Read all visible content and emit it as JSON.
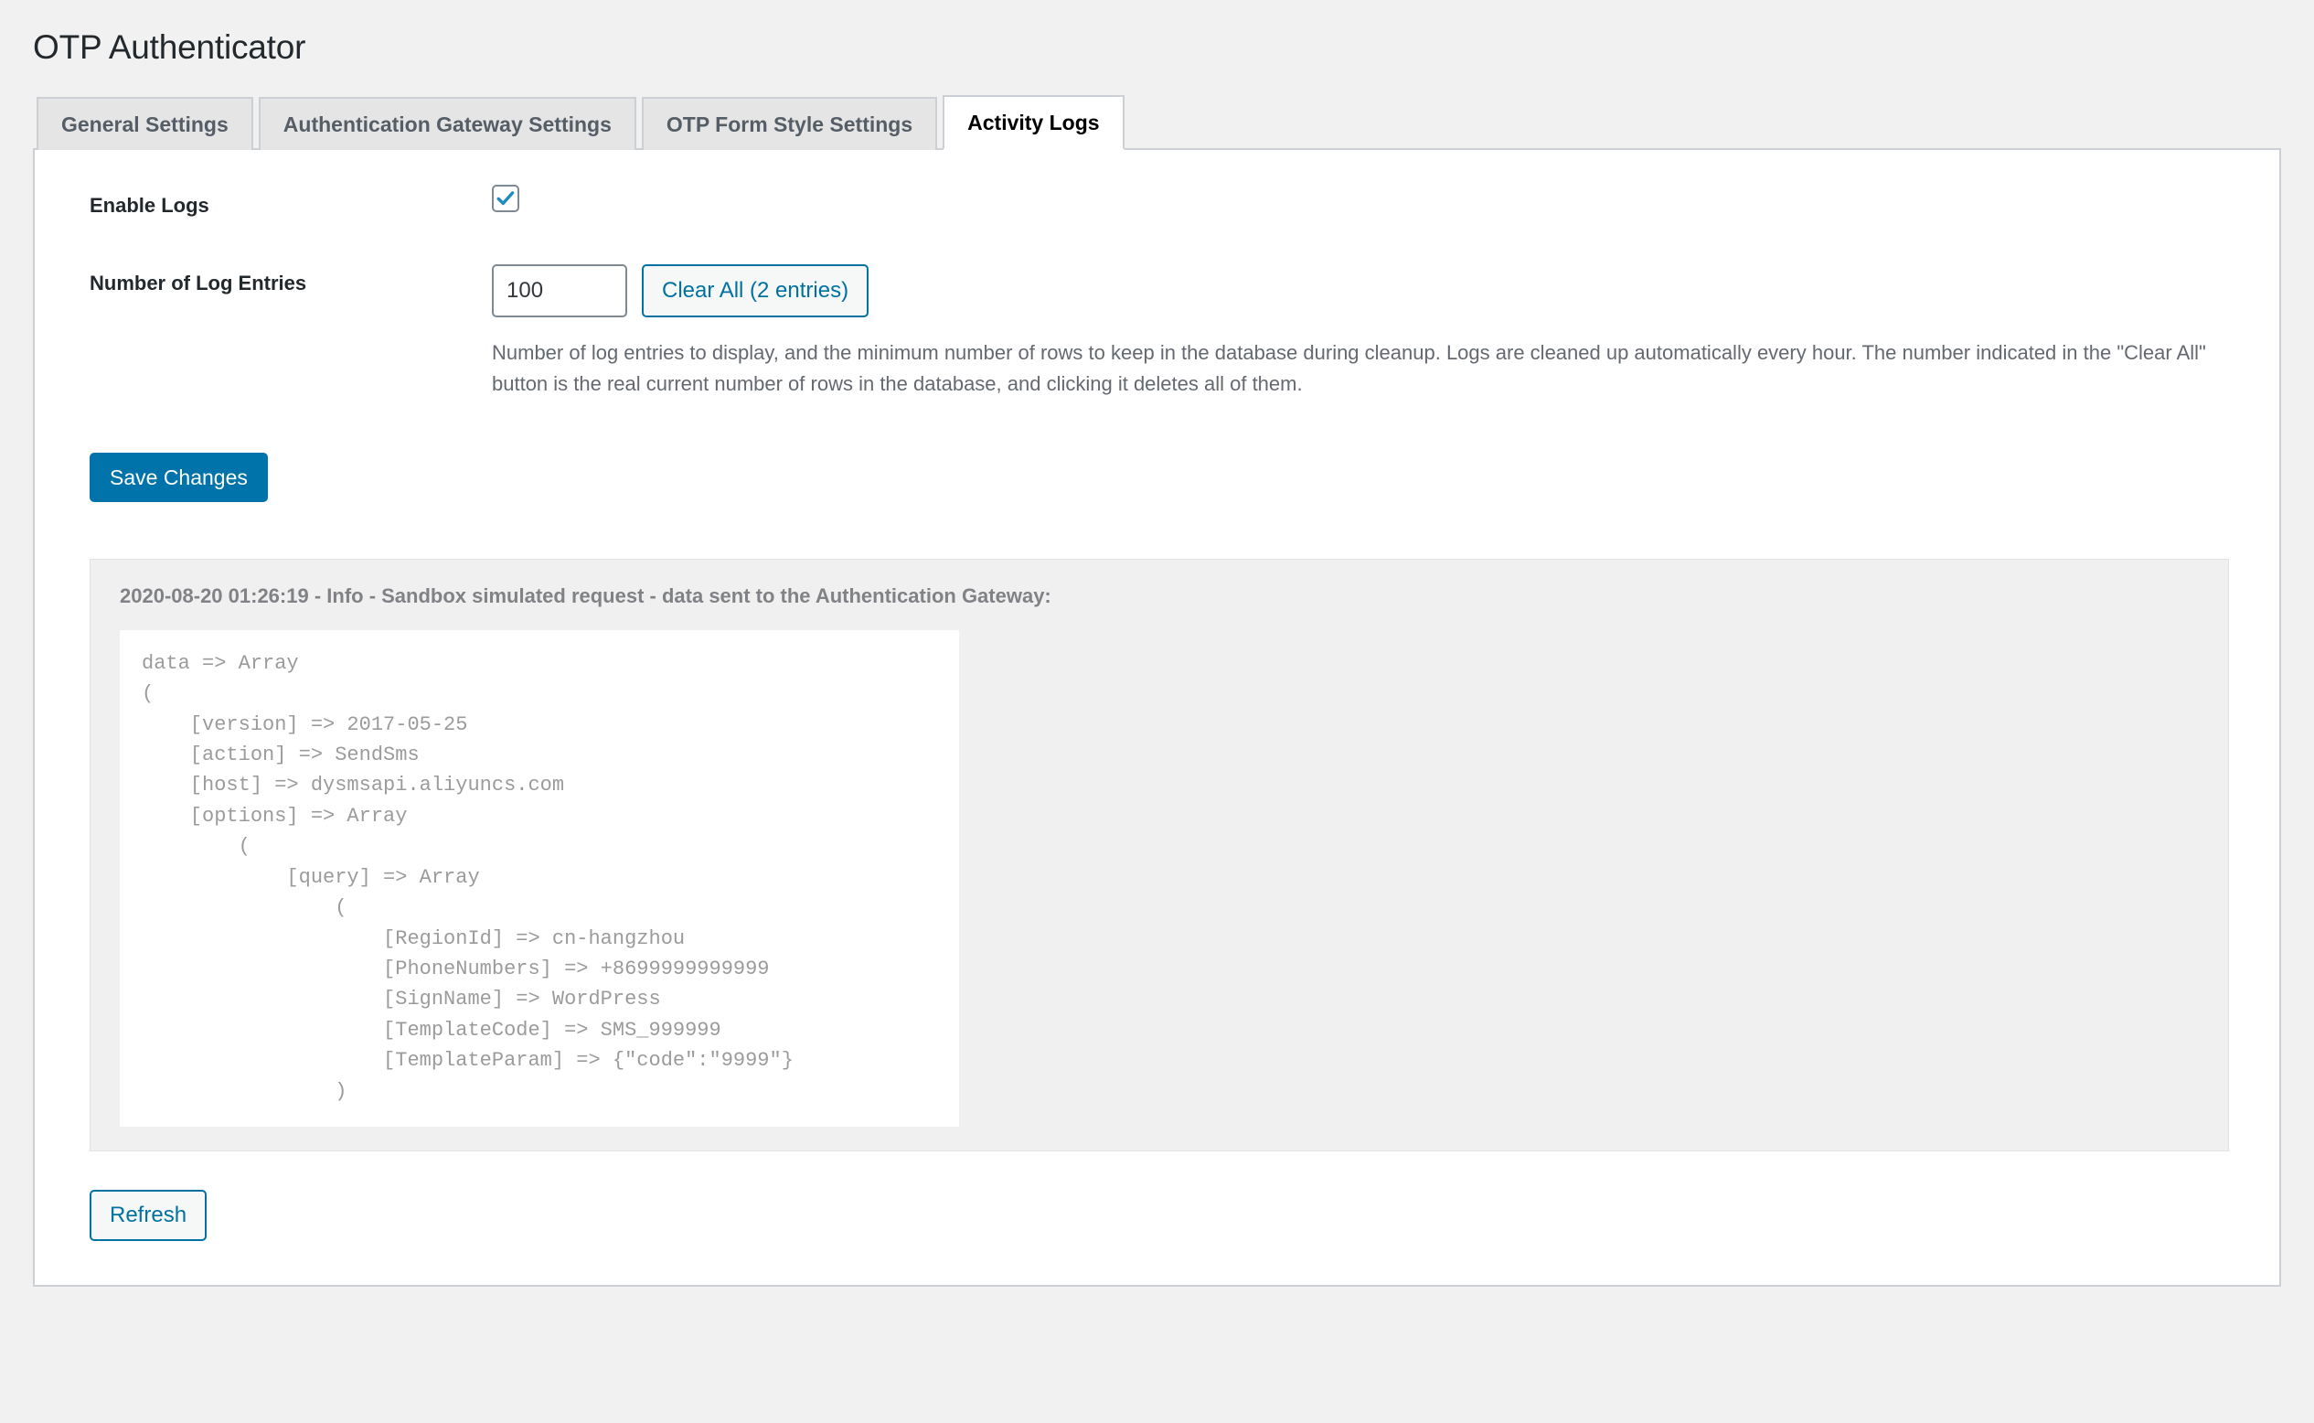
{
  "header": {
    "title": "OTP Authenticator"
  },
  "tabs": [
    {
      "label": "General Settings",
      "active": false
    },
    {
      "label": "Authentication Gateway Settings",
      "active": false
    },
    {
      "label": "OTP Form Style Settings",
      "active": false
    },
    {
      "label": "Activity Logs",
      "active": true
    }
  ],
  "settings": {
    "enable_logs": {
      "label": "Enable Logs",
      "checked": true,
      "icon": "check-icon"
    },
    "log_entries": {
      "label": "Number of Log Entries",
      "value": "100",
      "placeholder": "",
      "clear_all_label": "Clear All (2 entries)",
      "description": "Number of log entries to display, and the minimum number of rows to keep in the database during cleanup. Logs are cleaned up automatically every hour. The number indicated in the \"Clear All\" button is the real current number of rows in the database, and clicking it deletes all of them."
    },
    "save_label": "Save Changes"
  },
  "logs": {
    "entries": [
      {
        "title": "2020-08-20 01:26:19 - Info - Sandbox simulated request - data sent to the Authentication Gateway:",
        "body": "data => Array\n(\n    [version] => 2017-05-25\n    [action] => SendSms\n    [host] => dysmsapi.aliyuncs.com\n    [options] => Array\n        (\n            [query] => Array\n                (\n                    [RegionId] => cn-hangzhou\n                    [PhoneNumbers] => +8699999999999\n                    [SignName] => WordPress\n                    [TemplateCode] => SMS_999999\n                    [TemplateParam] => {\"code\":\"9999\"}\n                )"
      }
    ],
    "refresh_label": "Refresh"
  },
  "colors": {
    "accent_blue": "#0073aa",
    "link_blue": "#0071a1",
    "checkbox_check": "#1e8cbe",
    "page_bg": "#f1f1f1",
    "panel_bg": "#ffffff",
    "border": "#ccd0d4",
    "muted_text": "#646970",
    "code_text": "#9b9b9b"
  }
}
